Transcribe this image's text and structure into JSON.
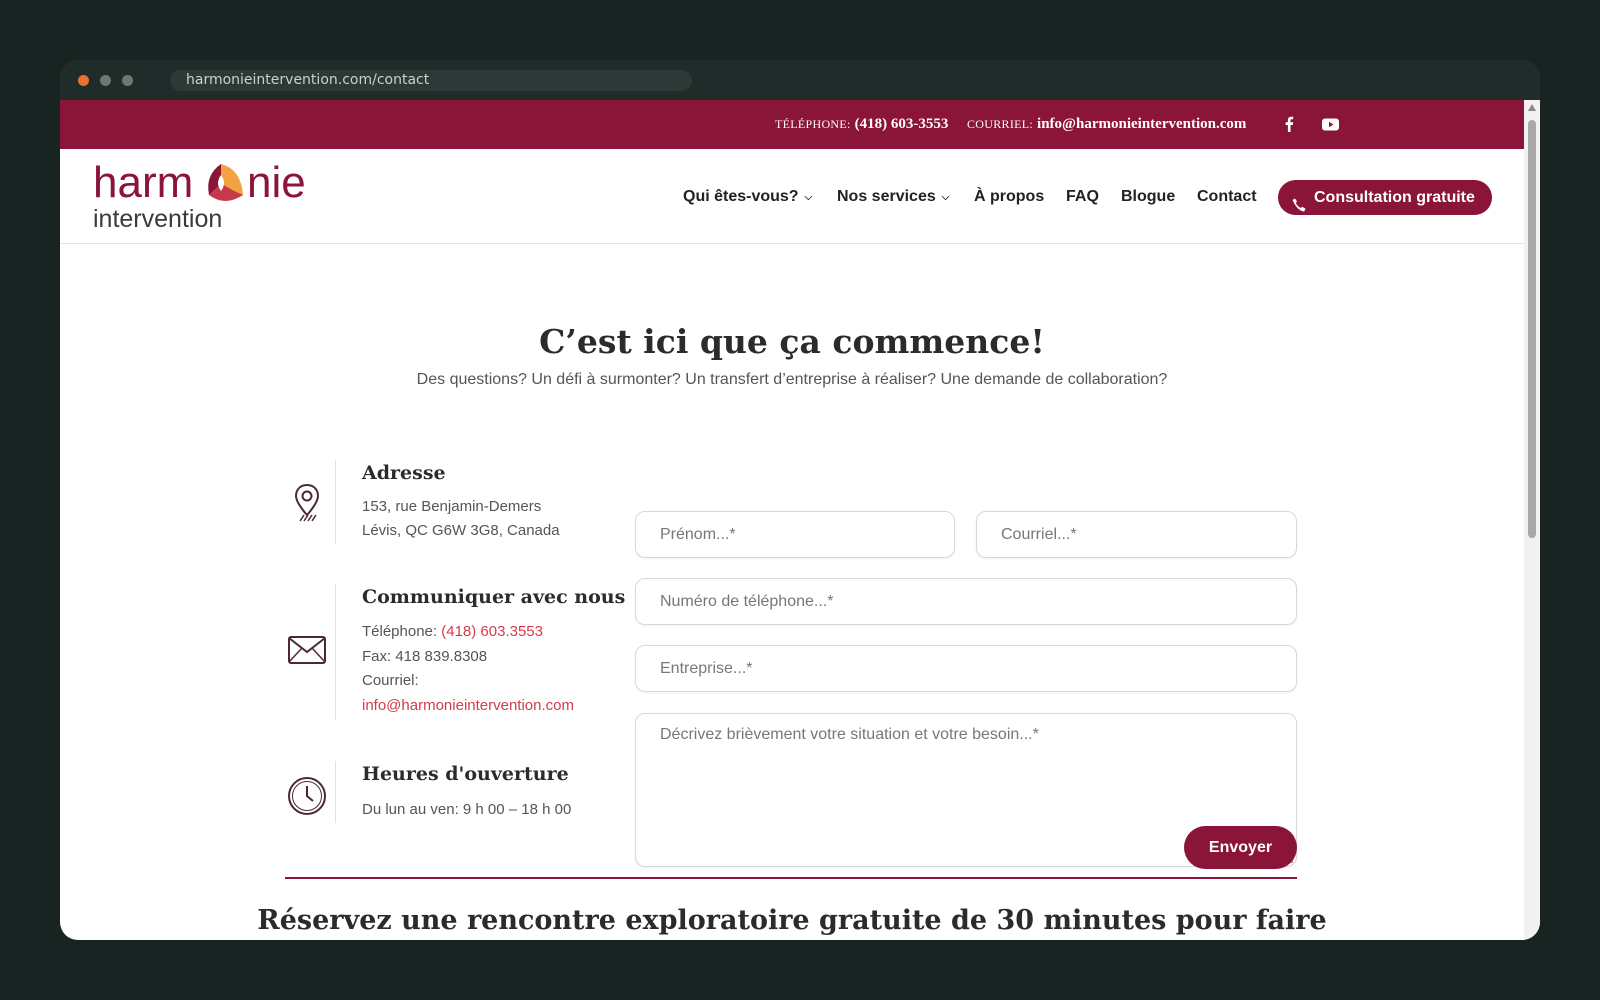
{
  "browser": {
    "url": "harmonieintervention.com/contact"
  },
  "topbar": {
    "phone_label": "TÉLÉPHONE:",
    "phone_value": "(418) 603-3553",
    "email_label": "COURRIEL:",
    "email_value": "info@harmonieintervention.com",
    "social": [
      "facebook-icon",
      "youtube-icon"
    ]
  },
  "header": {
    "logo_text": [
      "harm",
      "nie",
      "intervention"
    ],
    "nav": [
      "Qui êtes-vous?",
      "Nos services",
      "À propos",
      "FAQ",
      "Blogue",
      "Contact"
    ],
    "cta_label": "Consultation gratuite"
  },
  "hero": {
    "title": "C’est ici que ça commence!",
    "subtitle": "Des questions? Un défi à surmonter? Un transfert d’entreprise à réaliser? Une demande de collaboration?"
  },
  "contact_info": {
    "address": {
      "title": "Adresse",
      "line1": "153, rue Benjamin-Demers",
      "line2": "Lévis, QC G6W 3G8, Canada"
    },
    "communicate": {
      "title": "Communiquer avec nous",
      "phone_label": "Téléphone:",
      "phone_value": "(418) 603.3553",
      "fax": "Fax: 418 839.8308",
      "email_label": "Courriel:",
      "email_value": "info@harmonieintervention.com"
    },
    "hours": {
      "title": "Heures d'ouverture",
      "line": "Du lun au ven: 9 h 00 – 18 h 00"
    }
  },
  "form": {
    "firstname_placeholder": "Prénom...*",
    "email_placeholder": "Courriel...*",
    "phone_placeholder": "Numéro de téléphone...*",
    "company_placeholder": "Entreprise...*",
    "message_placeholder": "Décrivez brièvement votre situation et votre besoin...*",
    "submit_label": "Envoyer"
  },
  "booking": {
    "title": "Réservez une rencontre exploratoire gratuite de 30 minutes pour faire"
  },
  "colors": {
    "brand": "#8a1538",
    "link": "#d23b4d",
    "accent_orange": "#f0a340"
  }
}
